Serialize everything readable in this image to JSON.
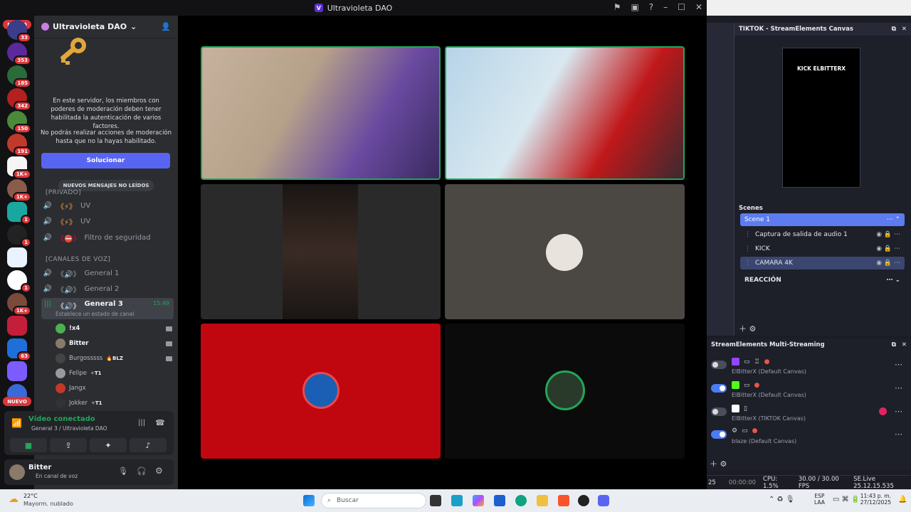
{
  "window": {
    "title": "Ultravioleta DAO"
  },
  "servers": {
    "nuevo": "NUEVO",
    "badges": [
      "33",
      "353",
      "185",
      "342",
      "150",
      "191",
      "1K+",
      "1K+",
      "1",
      "1",
      "1",
      "1K+",
      "63"
    ]
  },
  "server_header": {
    "name": "Ultravioleta DAO"
  },
  "mfa_notice": {
    "line1": "En este servidor, los miembros con poderes de moderación deben tener habilitada la autenticación de varios factores.",
    "line2": "No podrás realizar acciones de moderación hasta que no la hayas habilitado.",
    "button": "Solucionar"
  },
  "new_messages": "NUEVOS MENSAJES NO LEÍDOS",
  "categories": {
    "private": "[PRIVADO]",
    "voice": "[CANALES DE VOZ]"
  },
  "channels": [
    {
      "label": "UV"
    },
    {
      "label": "UV"
    },
    {
      "label": "Filtro de seguridad"
    },
    {
      "label": "General 1"
    },
    {
      "label": "General 2"
    }
  ],
  "active_channel": {
    "label": "General 3",
    "time": "15:49",
    "status": "Establece un estado de canal"
  },
  "voice_users": [
    {
      "name": "!x4",
      "tag": ""
    },
    {
      "name": "Bitter",
      "tag": ""
    },
    {
      "name": "Burgosssss",
      "tag": "BLZ"
    },
    {
      "name": "Felipe",
      "tag": "T1"
    },
    {
      "name": "Jangx",
      "tag": ""
    },
    {
      "name": "Jokker",
      "tag": "T1"
    }
  ],
  "voice_status": {
    "title": "Vídeo conectado",
    "subtitle": "General 3 / Ultravioleta DAO"
  },
  "user": {
    "name": "Bitter",
    "status": "En canal de voz"
  },
  "tiktok_panel": {
    "title": "TIKTOK - StreamElements Canvas",
    "preview_text": "KICK ELBITTERX"
  },
  "scenes": {
    "title": "Scenes",
    "active": "Scene 1",
    "sources": [
      "Captura de salida de audio 1",
      "KICK",
      "CAMARA 4K"
    ],
    "group": "REACCIÓN"
  },
  "multistream": {
    "title": "StreamElements Multi-Streaming",
    "rows": [
      {
        "label": "ElBitterX (Default Canvas)",
        "on": false,
        "color": "#9146ff"
      },
      {
        "label": "ElBitterX (Default Canvas)",
        "on": true,
        "color": "#53fc18"
      },
      {
        "label": "ElBitterX (TIKTOK Canvas)",
        "on": false,
        "color": "#ffffff"
      },
      {
        "label": "blaze (Default Canvas)",
        "on": true,
        "color": "#cfcfcf"
      }
    ]
  },
  "obs_status": {
    "left": "25",
    "time": "00:00:00",
    "cpu": "CPU: 1.5%",
    "fps": "30.00 / 30.00 FPS",
    "version": "SE.Live 25.12.15.535"
  },
  "taskbar": {
    "weather_temp": "22°C",
    "weather_desc": "Mayorm. nublado",
    "search": "Buscar",
    "lang1": "ESP",
    "lang2": "LAA",
    "time": "11:43 p. m.",
    "date": "27/12/2025"
  }
}
